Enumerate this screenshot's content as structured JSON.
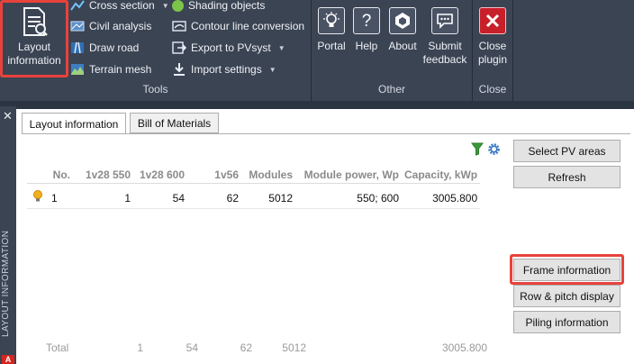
{
  "ribbon": {
    "layout_info_label_line1": "Layout",
    "layout_info_label_line2": "information",
    "tools_items": [
      {
        "label": "Cross section",
        "has_dropdown": true
      },
      {
        "label": "Civil analysis",
        "has_dropdown": false
      },
      {
        "label": "Draw road",
        "has_dropdown": false
      },
      {
        "label": "Terrain mesh",
        "has_dropdown": false
      }
    ],
    "tools_items2": [
      {
        "label": "Shading objects",
        "has_dropdown": false
      },
      {
        "label": "Contour line conversion",
        "has_dropdown": false
      },
      {
        "label": "Export to PVsyst",
        "has_dropdown": true
      },
      {
        "label": "Import settings",
        "has_dropdown": true
      }
    ],
    "tools_group_label": "Tools",
    "other_buttons": [
      {
        "label": "Portal"
      },
      {
        "label": "Help"
      },
      {
        "label": "About"
      },
      {
        "label_line1": "Submit",
        "label_line2": "feedback"
      }
    ],
    "other_group_label": "Other",
    "close_button": {
      "label_line1": "Close",
      "label_line2": "plugin"
    },
    "close_group_label": "Close",
    "help_glyph": "?"
  },
  "side_panel": {
    "title": "LAYOUT INFORMATION",
    "close_glyph": "✕",
    "logo_glyph": "A"
  },
  "panel": {
    "tabs": [
      {
        "label": "Layout information",
        "active": true
      },
      {
        "label": "Bill of Materials",
        "active": false
      }
    ],
    "table": {
      "columns": [
        "No.",
        "1v28 550",
        "1v28 600",
        "1v56",
        "Modules",
        "Module power, Wp",
        "Capacity, kWp"
      ],
      "rows": [
        {
          "no": "1",
          "c1": "1",
          "c2": "54",
          "c3": "62",
          "modules": "5012",
          "power": "550; 600",
          "capacity": "3005.800"
        }
      ],
      "total": {
        "label": "Total",
        "c1": "1",
        "c2": "54",
        "c3": "62",
        "modules": "5012",
        "capacity": "3005.800"
      }
    },
    "buttons": {
      "select_pv": "Select PV areas",
      "refresh": "Refresh",
      "frame_info": "Frame information",
      "row_pitch": "Row & pitch display",
      "piling": "Piling information"
    }
  },
  "colors": {
    "ribbon_bg": "#3b4453",
    "highlight": "#e8423c",
    "close_red": "#c8202a"
  }
}
